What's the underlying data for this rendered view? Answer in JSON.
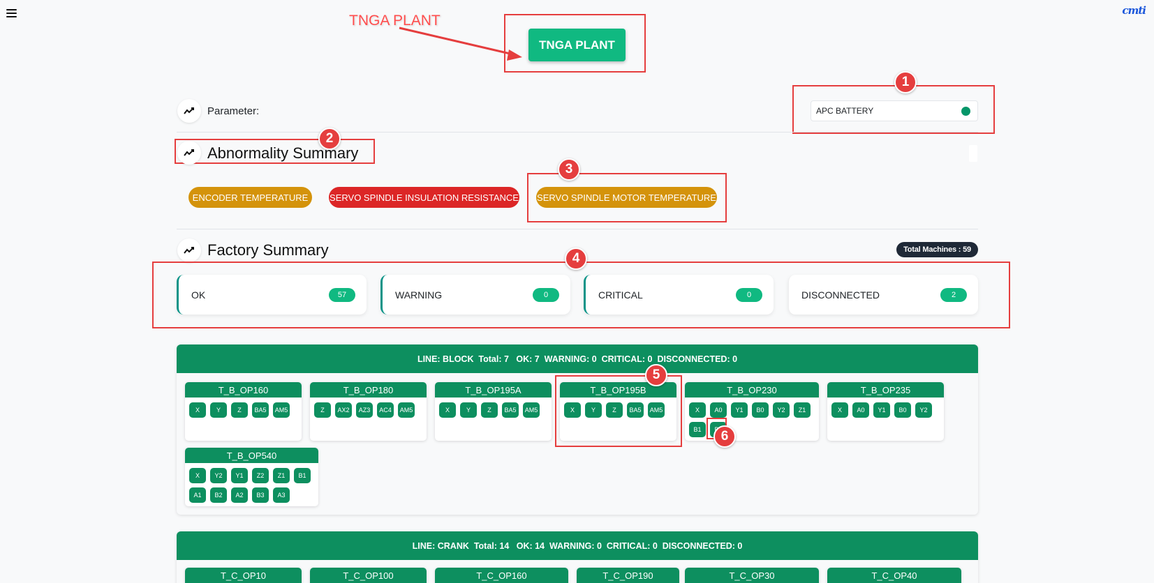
{
  "annotation_label": "TNGA PLANT",
  "plant_button": "TNGA PLANT",
  "parameter": {
    "label": "Parameter:",
    "selected": "APC BATTERY",
    "status_color": "#059669"
  },
  "abnormality": {
    "title": "Abnormality Summary",
    "pills": [
      {
        "label": "ENCODER TEMPERATURE",
        "color": "#d4930b"
      },
      {
        "label": "SERVO SPINDLE INSULATION RESISTANCE",
        "color": "#dc2626"
      },
      {
        "label": "SERVO SPINDLE MOTOR TEMPERATURE",
        "color": "#d4930b"
      }
    ]
  },
  "factory": {
    "title": "Factory Summary",
    "total_machines": "Total Machines : 59",
    "statuses": [
      {
        "label": "OK",
        "count": "57"
      },
      {
        "label": "WARNING",
        "count": "0"
      },
      {
        "label": "CRITICAL",
        "count": "0"
      },
      {
        "label": "DISCONNECTED",
        "count": "2"
      }
    ]
  },
  "badges": [
    "1",
    "2",
    "3",
    "4",
    "5",
    "6"
  ],
  "lines": [
    {
      "header": "LINE: BLOCK  Total: 7   OK: 7  WARNING: 0  CRITICAL: 0  DISCONNECTED: 0",
      "machines": [
        {
          "name": "T_B_OP160",
          "axes": [
            "X",
            "Y",
            "Z",
            "BA5",
            "AM5"
          ]
        },
        {
          "name": "T_B_OP180",
          "axes": [
            "Z",
            "AX2",
            "AZ3",
            "AC4",
            "AM5"
          ]
        },
        {
          "name": "T_B_OP195A",
          "axes": [
            "X",
            "Y",
            "Z",
            "BA5",
            "AM5"
          ]
        },
        {
          "name": "T_B_OP195B",
          "axes": [
            "X",
            "Y",
            "Z",
            "BA5",
            "AM5"
          ]
        },
        {
          "name": "T_B_OP230",
          "axes": [
            "X",
            "A0",
            "Y1",
            "B0",
            "Y2",
            "Z1",
            "B1",
            "B2"
          ]
        },
        {
          "name": "T_B_OP235",
          "axes": [
            "X",
            "A0",
            "Y1",
            "B0",
            "Y2"
          ]
        },
        {
          "name": "T_B_OP540",
          "axes": [
            "X",
            "Y2",
            "Y1",
            "Z2",
            "Z1",
            "B1",
            "A1",
            "B2",
            "A2",
            "B3",
            "A3"
          ]
        }
      ]
    },
    {
      "header": "LINE: CRANK  Total: 14   OK: 14  WARNING: 0  CRITICAL: 0  DISCONNECTED: 0",
      "machines": [
        {
          "name": "T_C_OP10",
          "axes": []
        },
        {
          "name": "T_C_OP100",
          "axes": []
        },
        {
          "name": "T_C_OP160",
          "axes": []
        },
        {
          "name": "T_C_OP190",
          "axes": []
        },
        {
          "name": "T_C_OP30",
          "axes": []
        },
        {
          "name": "T_C_OP40",
          "axes": []
        }
      ]
    }
  ]
}
